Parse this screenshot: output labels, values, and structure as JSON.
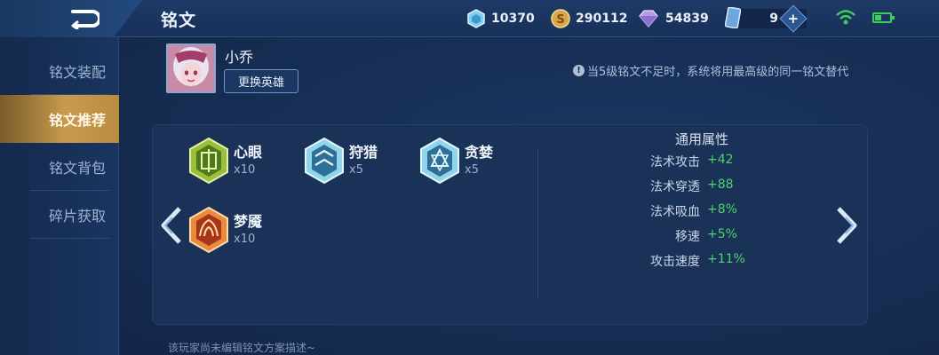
{
  "header": {
    "title": "铭文",
    "back_icon": "back-arrow-icon",
    "resources": {
      "gems": "10370",
      "coins": "290112",
      "crystals": "54839",
      "cards": "9"
    },
    "add_label": "+"
  },
  "sidebar": {
    "items": [
      {
        "label": "铭文装配",
        "active": false
      },
      {
        "label": "铭文推荐",
        "active": true
      },
      {
        "label": "铭文背包",
        "active": false
      },
      {
        "label": "碎片获取",
        "active": false
      }
    ]
  },
  "hero": {
    "name": "小乔",
    "change_button": "更换英雄",
    "notice": "当5级铭文不足时，系统将用最高级的同一铭文替代"
  },
  "runes": [
    {
      "name": "心眼",
      "count": "x10",
      "color": "#6f9a2e"
    },
    {
      "name": "狩猎",
      "count": "x5",
      "color": "#4aa3c4"
    },
    {
      "name": "贪婪",
      "count": "x5",
      "color": "#4aa3c4"
    },
    {
      "name": "梦魇",
      "count": "x10",
      "color": "#c8501e"
    }
  ],
  "attributes": {
    "title": "通用属性",
    "rows": [
      {
        "name": "法术攻击",
        "value": "+42"
      },
      {
        "name": "法术穿透",
        "value": "+88"
      },
      {
        "name": "法术吸血",
        "value": "+8%"
      },
      {
        "name": "移速",
        "value": "+5%"
      },
      {
        "name": "攻击速度",
        "value": "+11%"
      }
    ]
  },
  "footer": {
    "note": "该玩家尚未编辑铭文方案描述~"
  },
  "colors": {
    "accent_gold": "#c79a4d",
    "positive_green": "#4fd36a",
    "background": "#14284a"
  }
}
